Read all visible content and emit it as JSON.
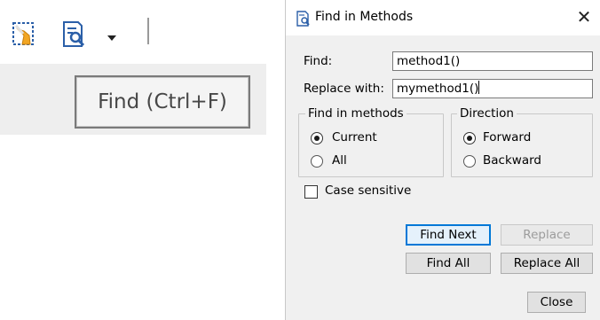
{
  "toolbar": {
    "icons": [
      "clear-format-icon",
      "find-icon",
      "dropdown-arrow-icon"
    ],
    "tooltip": "Find (Ctrl+F)"
  },
  "dialog": {
    "title": "Find in Methods",
    "close_glyph": "✕",
    "find_label": "Find:",
    "find_value": "method1()",
    "replace_label": "Replace with:",
    "replace_value": "mymethod1()",
    "scope": {
      "title": "Find in methods",
      "options": [
        "Current",
        "All"
      ],
      "selected": "Current"
    },
    "direction": {
      "title": "Direction",
      "options": [
        "Forward",
        "Backward"
      ],
      "selected": "Forward"
    },
    "case_sensitive": {
      "label": "Case sensitive",
      "checked": false
    },
    "buttons": {
      "find_next": "Find Next",
      "replace": "Replace",
      "find_all": "Find All",
      "replace_all": "Replace All",
      "close": "Close"
    },
    "colors": {
      "accent": "#0078d7",
      "dialog_bg": "#f0f0f0"
    }
  }
}
